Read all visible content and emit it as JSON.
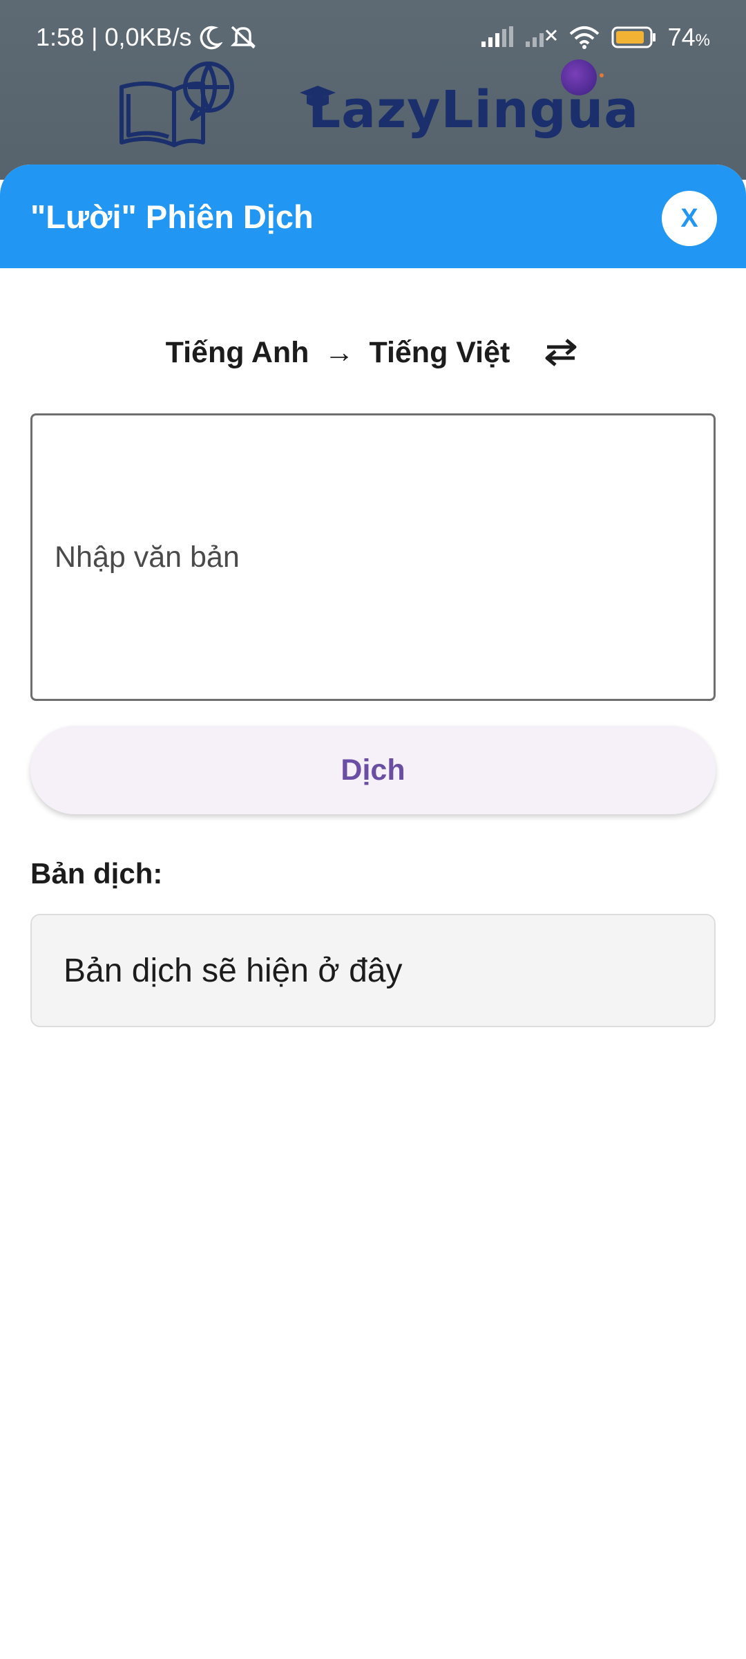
{
  "status_bar": {
    "time": "1:58",
    "network_speed": "0,0KB/s",
    "battery_percent": "74",
    "battery_unit": "%",
    "icons": [
      "moon-icon",
      "mute-notification-icon",
      "signal-icon",
      "signal-no-service-icon",
      "wifi-icon",
      "battery-icon"
    ]
  },
  "background_app": {
    "brand_name": "LazyLingua"
  },
  "sheet": {
    "title": "\"Lười\" Phiên Dịch",
    "close_label": "X",
    "language": {
      "source": "Tiếng Anh",
      "arrow": "→",
      "target": "Tiếng Việt"
    },
    "input": {
      "value": "",
      "placeholder": "Nhập văn bản"
    },
    "translate_label": "Dịch",
    "result_label": "Bản dịch:",
    "result_text": "Bản dịch sẽ hiện ở đây"
  },
  "colors": {
    "header": "#2196f3",
    "button_text": "#6a4ea3",
    "button_bg": "#f6f1f9",
    "brand": "#1a2f6b"
  }
}
